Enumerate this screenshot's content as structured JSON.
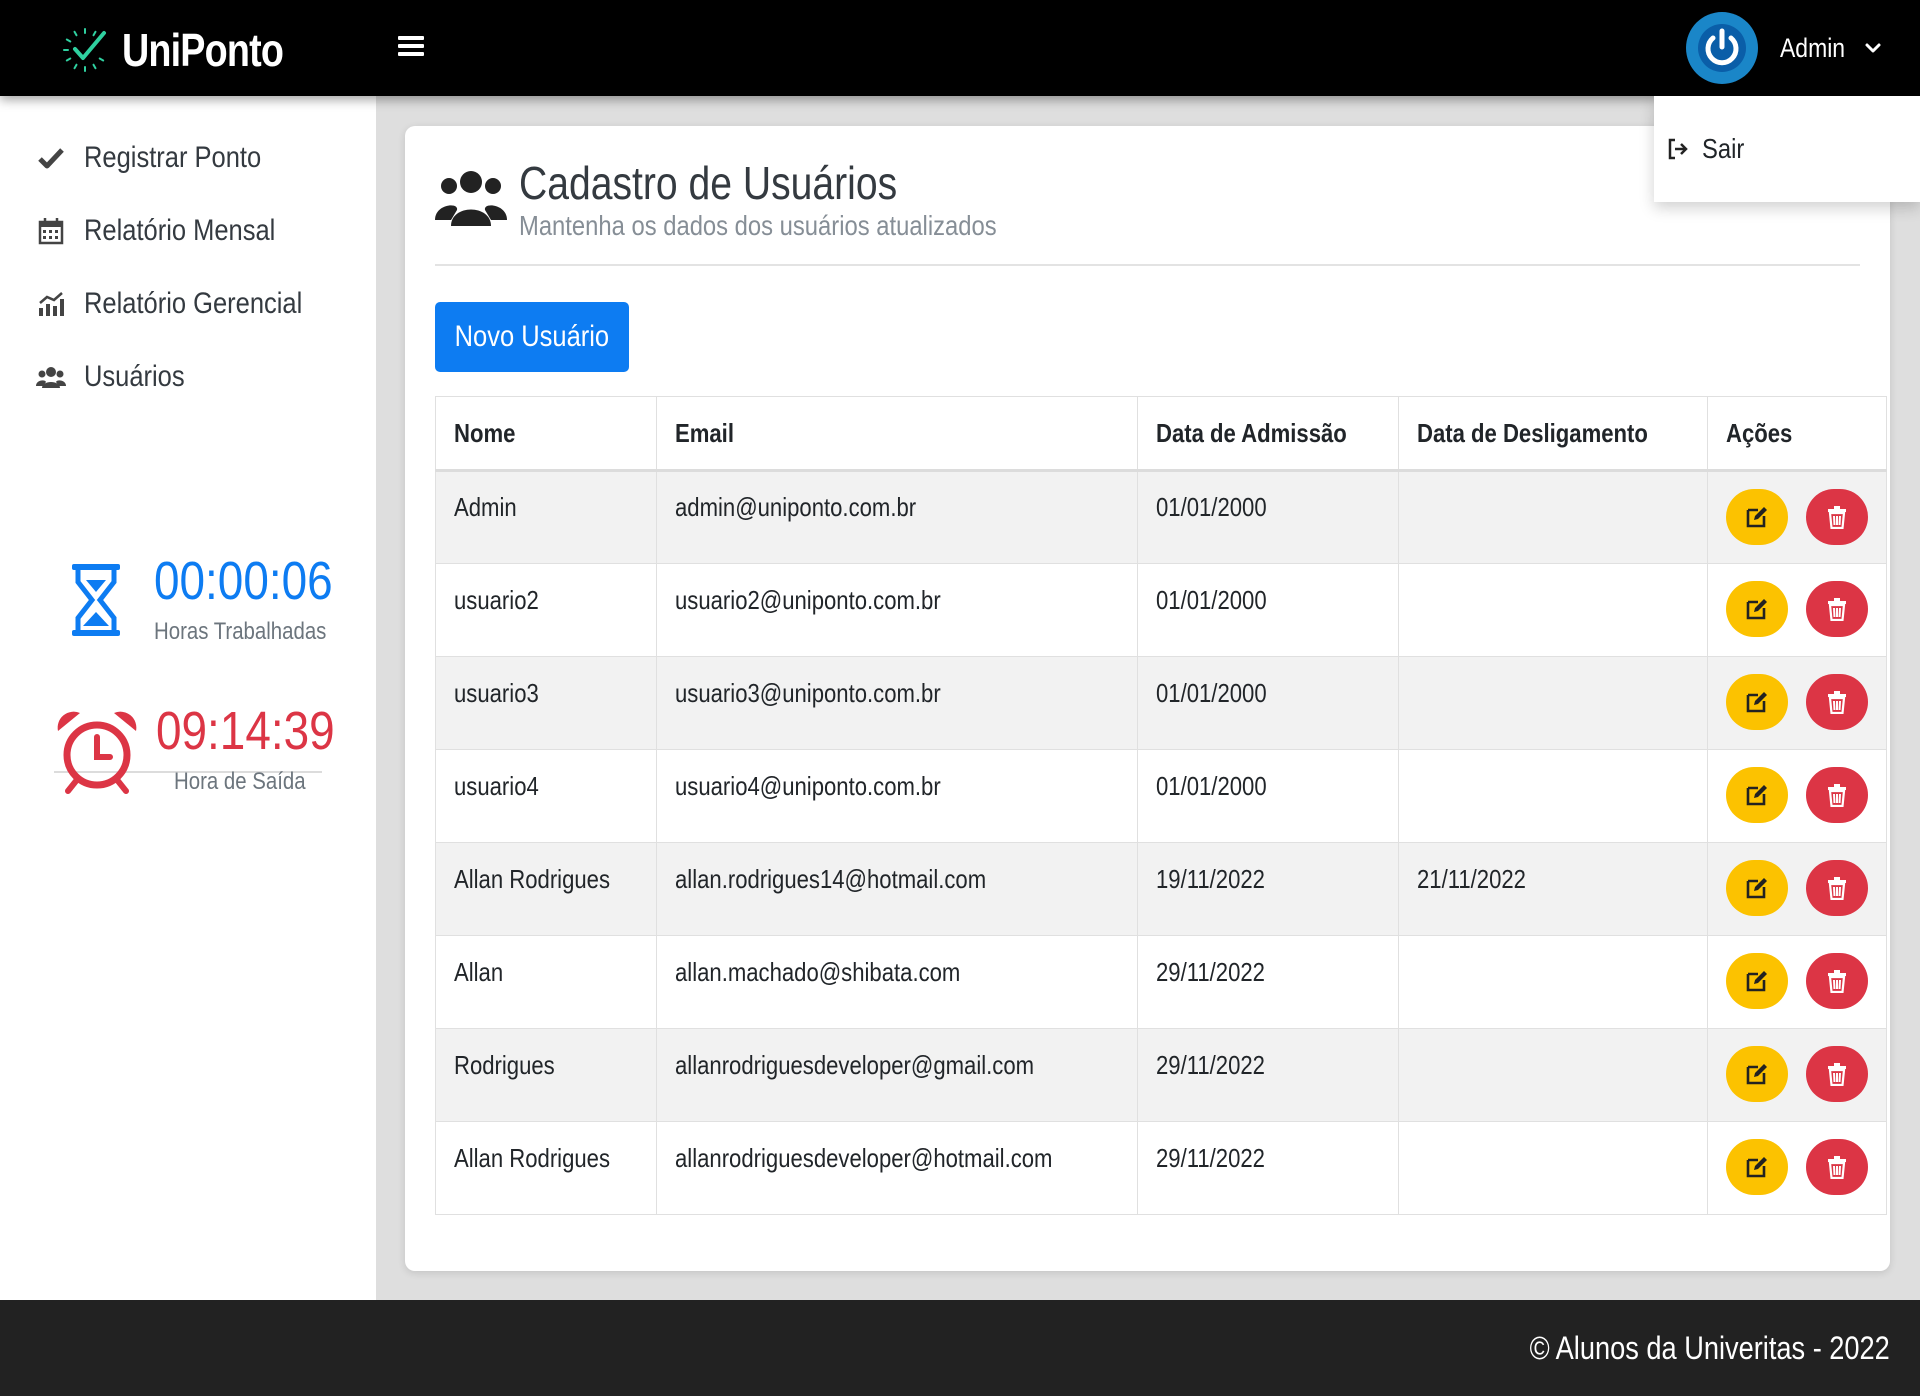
{
  "header": {
    "brand": "UniPonto",
    "user": "Admin"
  },
  "dropdown": {
    "logout": "Sair"
  },
  "sidebar": {
    "items": [
      {
        "label": "Registrar Ponto",
        "icon": "check-icon"
      },
      {
        "label": "Relatório Mensal",
        "icon": "calendar-icon"
      },
      {
        "label": "Relatório Gerencial",
        "icon": "chart-icon"
      },
      {
        "label": "Usuários",
        "icon": "users-icon"
      }
    ],
    "worked": {
      "value": "00:00:06",
      "label": "Horas Trabalhadas"
    },
    "exit": {
      "value": "09:14:39",
      "label": "Hora de Saída"
    }
  },
  "page": {
    "title": "Cadastro de Usuários",
    "subtitle": "Mantenha os dados dos usuários atualizados",
    "new_button": "Novo Usuário"
  },
  "table": {
    "headers": [
      "Nome",
      "Email",
      "Data de Admissão",
      "Data de Desligamento",
      "Ações"
    ],
    "rows": [
      {
        "name": "Admin",
        "email": "admin@uniponto.com.br",
        "admission": "01/01/2000",
        "dismissal": ""
      },
      {
        "name": "usuario2",
        "email": "usuario2@uniponto.com.br",
        "admission": "01/01/2000",
        "dismissal": ""
      },
      {
        "name": "usuario3",
        "email": "usuario3@uniponto.com.br",
        "admission": "01/01/2000",
        "dismissal": ""
      },
      {
        "name": "usuario4",
        "email": "usuario4@uniponto.com.br",
        "admission": "01/01/2000",
        "dismissal": ""
      },
      {
        "name": "Allan Rodrigues",
        "email": "allan.rodrigues14@hotmail.com",
        "admission": "19/11/2022",
        "dismissal": "21/11/2022"
      },
      {
        "name": "Allan",
        "email": "allan.machado@shibata.com",
        "admission": "29/11/2022",
        "dismissal": ""
      },
      {
        "name": "Rodrigues",
        "email": "allanrodriguesdeveloper@gmail.com",
        "admission": "29/11/2022",
        "dismissal": ""
      },
      {
        "name": "Allan Rodrigues",
        "email": "allanrodriguesdeveloper@hotmail.com",
        "admission": "29/11/2022",
        "dismissal": ""
      }
    ]
  },
  "footer": {
    "text": "© Alunos da Univeritas - 2022"
  },
  "colors": {
    "primary": "#0d7cf2",
    "danger": "#dc3545",
    "warning": "#fcc200",
    "header_bg": "#000000",
    "footer_bg": "#222222",
    "brand_accent": "#2fd0a0"
  }
}
